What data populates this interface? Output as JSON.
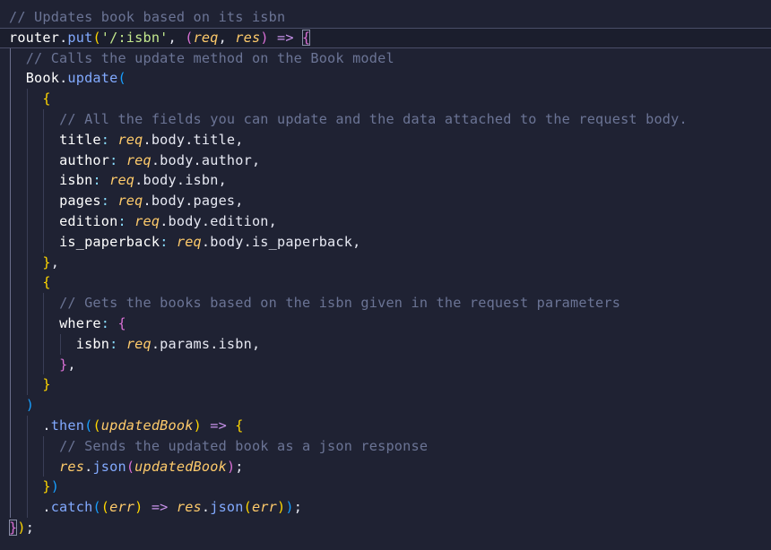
{
  "editor": {
    "lines": [
      {
        "id": "l1",
        "indent": 0,
        "tokens": [
          {
            "c": "cm",
            "t": "// Updates book based on its isbn"
          }
        ]
      },
      {
        "id": "l2",
        "indent": 0,
        "current": true,
        "tokens": [
          {
            "c": "prop",
            "t": "router"
          },
          {
            "c": "punc",
            "t": "."
          },
          {
            "c": "fn",
            "t": "put"
          },
          {
            "c": "b1",
            "t": "("
          },
          {
            "c": "str",
            "t": "'/:isbn'"
          },
          {
            "c": "punc",
            "t": ", "
          },
          {
            "c": "b2",
            "t": "("
          },
          {
            "c": "var",
            "t": "req"
          },
          {
            "c": "punc",
            "t": ", "
          },
          {
            "c": "var",
            "t": "res"
          },
          {
            "c": "b2",
            "t": ")"
          },
          {
            "c": "punc",
            "t": " "
          },
          {
            "c": "kw",
            "t": "=>"
          },
          {
            "c": "punc",
            "t": " "
          },
          {
            "c": "b2 bracket-match",
            "t": "{"
          }
        ]
      },
      {
        "id": "l3",
        "indent": 1,
        "tokens": [
          {
            "c": "cm",
            "t": "// Calls the update method on the Book model"
          }
        ]
      },
      {
        "id": "l4",
        "indent": 1,
        "tokens": [
          {
            "c": "prop",
            "t": "Book"
          },
          {
            "c": "punc",
            "t": "."
          },
          {
            "c": "fn",
            "t": "update"
          },
          {
            "c": "b3",
            "t": "("
          }
        ]
      },
      {
        "id": "l5",
        "indent": 2,
        "tokens": [
          {
            "c": "b1",
            "t": "{"
          }
        ]
      },
      {
        "id": "l6",
        "indent": 3,
        "tokens": [
          {
            "c": "cm",
            "t": "// All the fields you can update and the data attached to the request body."
          }
        ]
      },
      {
        "id": "l7",
        "indent": 3,
        "tokens": [
          {
            "c": "prop",
            "t": "title"
          },
          {
            "c": "op",
            "t": ": "
          },
          {
            "c": "var",
            "t": "req"
          },
          {
            "c": "punc",
            "t": ".body.title,"
          }
        ]
      },
      {
        "id": "l8",
        "indent": 3,
        "tokens": [
          {
            "c": "prop",
            "t": "author"
          },
          {
            "c": "op",
            "t": ": "
          },
          {
            "c": "var",
            "t": "req"
          },
          {
            "c": "punc",
            "t": ".body.author,"
          }
        ]
      },
      {
        "id": "l9",
        "indent": 3,
        "tokens": [
          {
            "c": "prop",
            "t": "isbn"
          },
          {
            "c": "op",
            "t": ": "
          },
          {
            "c": "var",
            "t": "req"
          },
          {
            "c": "punc",
            "t": ".body.isbn,"
          }
        ]
      },
      {
        "id": "l10",
        "indent": 3,
        "tokens": [
          {
            "c": "prop",
            "t": "pages"
          },
          {
            "c": "op",
            "t": ": "
          },
          {
            "c": "var",
            "t": "req"
          },
          {
            "c": "punc",
            "t": ".body.pages,"
          }
        ]
      },
      {
        "id": "l11",
        "indent": 3,
        "tokens": [
          {
            "c": "prop",
            "t": "edition"
          },
          {
            "c": "op",
            "t": ": "
          },
          {
            "c": "var",
            "t": "req"
          },
          {
            "c": "punc",
            "t": ".body.edition,"
          }
        ]
      },
      {
        "id": "l12",
        "indent": 3,
        "tokens": [
          {
            "c": "prop",
            "t": "is_paperback"
          },
          {
            "c": "op",
            "t": ": "
          },
          {
            "c": "var",
            "t": "req"
          },
          {
            "c": "punc",
            "t": ".body.is_paperback,"
          }
        ]
      },
      {
        "id": "l13",
        "indent": 2,
        "tokens": [
          {
            "c": "b1",
            "t": "}"
          },
          {
            "c": "punc",
            "t": ","
          }
        ]
      },
      {
        "id": "l14",
        "indent": 2,
        "tokens": [
          {
            "c": "b1",
            "t": "{"
          }
        ]
      },
      {
        "id": "l15",
        "indent": 3,
        "tokens": [
          {
            "c": "cm",
            "t": "// Gets the books based on the isbn given in the request parameters"
          }
        ]
      },
      {
        "id": "l16",
        "indent": 3,
        "tokens": [
          {
            "c": "prop",
            "t": "where"
          },
          {
            "c": "op",
            "t": ": "
          },
          {
            "c": "b2",
            "t": "{"
          }
        ]
      },
      {
        "id": "l17",
        "indent": 4,
        "tokens": [
          {
            "c": "prop",
            "t": "isbn"
          },
          {
            "c": "op",
            "t": ": "
          },
          {
            "c": "var",
            "t": "req"
          },
          {
            "c": "punc",
            "t": ".params.isbn,"
          }
        ]
      },
      {
        "id": "l18",
        "indent": 3,
        "tokens": [
          {
            "c": "b2",
            "t": "}"
          },
          {
            "c": "punc",
            "t": ","
          }
        ]
      },
      {
        "id": "l19",
        "indent": 2,
        "tokens": [
          {
            "c": "b1",
            "t": "}"
          }
        ]
      },
      {
        "id": "l20",
        "indent": 1,
        "tokens": [
          {
            "c": "b3",
            "t": ")"
          }
        ]
      },
      {
        "id": "l21",
        "indent": 2,
        "tokens": [
          {
            "c": "punc",
            "t": "."
          },
          {
            "c": "fn",
            "t": "then"
          },
          {
            "c": "b3",
            "t": "("
          },
          {
            "c": "b1",
            "t": "("
          },
          {
            "c": "var",
            "t": "updatedBook"
          },
          {
            "c": "b1",
            "t": ")"
          },
          {
            "c": "punc",
            "t": " "
          },
          {
            "c": "kw",
            "t": "=>"
          },
          {
            "c": "punc",
            "t": " "
          },
          {
            "c": "b1",
            "t": "{"
          }
        ]
      },
      {
        "id": "l22",
        "indent": 3,
        "tokens": [
          {
            "c": "cm",
            "t": "// Sends the updated book as a json response"
          }
        ]
      },
      {
        "id": "l23",
        "indent": 3,
        "tokens": [
          {
            "c": "var",
            "t": "res"
          },
          {
            "c": "punc",
            "t": "."
          },
          {
            "c": "fn",
            "t": "json"
          },
          {
            "c": "b2",
            "t": "("
          },
          {
            "c": "var",
            "t": "updatedBook"
          },
          {
            "c": "b2",
            "t": ")"
          },
          {
            "c": "punc",
            "t": ";"
          }
        ]
      },
      {
        "id": "l24",
        "indent": 2,
        "tokens": [
          {
            "c": "b1",
            "t": "}"
          },
          {
            "c": "b3",
            "t": ")"
          }
        ]
      },
      {
        "id": "l25",
        "indent": 2,
        "tokens": [
          {
            "c": "punc",
            "t": "."
          },
          {
            "c": "fn",
            "t": "catch"
          },
          {
            "c": "b3",
            "t": "("
          },
          {
            "c": "b1",
            "t": "("
          },
          {
            "c": "var",
            "t": "err"
          },
          {
            "c": "b1",
            "t": ")"
          },
          {
            "c": "punc",
            "t": " "
          },
          {
            "c": "kw",
            "t": "=>"
          },
          {
            "c": "punc",
            "t": " "
          },
          {
            "c": "var",
            "t": "res"
          },
          {
            "c": "punc",
            "t": "."
          },
          {
            "c": "fn",
            "t": "json"
          },
          {
            "c": "b1",
            "t": "("
          },
          {
            "c": "var",
            "t": "err"
          },
          {
            "c": "b1",
            "t": ")"
          },
          {
            "c": "b3",
            "t": ")"
          },
          {
            "c": "punc",
            "t": ";"
          }
        ]
      },
      {
        "id": "l26",
        "indent": 0,
        "tokens": [
          {
            "c": "b2 bracket-match",
            "t": "}"
          },
          {
            "c": "b1",
            "t": ")"
          },
          {
            "c": "punc",
            "t": ";"
          }
        ]
      }
    ]
  },
  "colors": {
    "background": "#1f2233",
    "comment": "#6b7495",
    "function": "#82aaff",
    "variable": "#ffcb6b",
    "string": "#c3e88d",
    "keyword": "#c792ea"
  }
}
